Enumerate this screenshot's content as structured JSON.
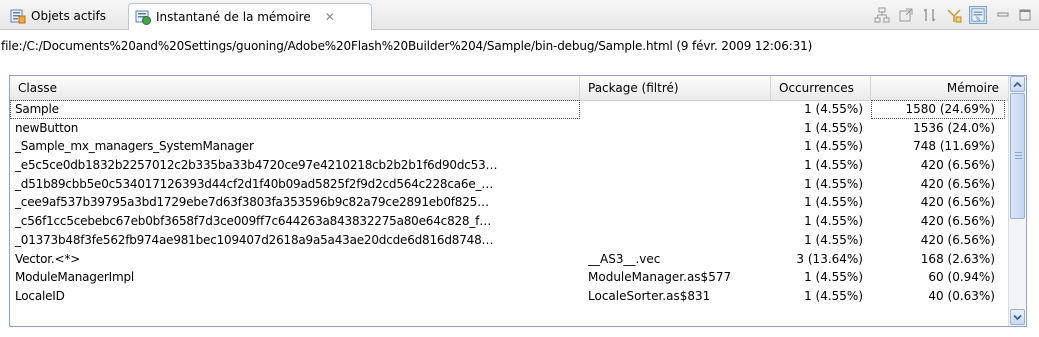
{
  "tabs": [
    {
      "label": "Objets actifs",
      "icon": "live-objects-icon"
    },
    {
      "label": "Instantané de la mémoire",
      "icon": "memory-snapshot-icon",
      "active": true
    }
  ],
  "path": "file:/C:/Documents%20and%20Settings/guoning/Adobe%20Flash%20Builder%204/Sample/bin-debug/Sample.html (9 févr. 2009 12:06:31)",
  "columns": [
    "Classe",
    "Package (filtré)",
    "Occurrences",
    "Mémoire"
  ],
  "rows": [
    {
      "classe": "Sample",
      "package": "",
      "occurrences": "1 (4.55%)",
      "memoire": "1580 (24.69%)"
    },
    {
      "classe": "newButton",
      "package": "",
      "occurrences": "1 (4.55%)",
      "memoire": "1536 (24.0%)"
    },
    {
      "classe": "_Sample_mx_managers_SystemManager",
      "package": "",
      "occurrences": "1 (4.55%)",
      "memoire": "748 (11.69%)"
    },
    {
      "classe": "_e5c5ce0db1832b2257012c2b335ba33b4720ce97e4210218cb2b2b1f6d90dc53…",
      "package": "",
      "occurrences": "1 (4.55%)",
      "memoire": "420 (6.56%)"
    },
    {
      "classe": "_d51b89cbb5e0c534017126393d44cf2d1f40b09ad5825f2f9d2cd564c228ca6e_…",
      "package": "",
      "occurrences": "1 (4.55%)",
      "memoire": "420 (6.56%)"
    },
    {
      "classe": "_cee9af537b39795a3bd1729ebe7d63f3803fa353596b9c82a79ce2891eb0f825…",
      "package": "",
      "occurrences": "1 (4.55%)",
      "memoire": "420 (6.56%)"
    },
    {
      "classe": "_c56f1cc5cebebc67eb0bf3658f7d3ce009ff7c644263a843832275a80e64c828_f…",
      "package": "",
      "occurrences": "1 (4.55%)",
      "memoire": "420 (6.56%)"
    },
    {
      "classe": "_01373b48f3fe562fb974ae981bec109407d2618a9a5a43ae20dcde6d816d8748…",
      "package": "",
      "occurrences": "1 (4.55%)",
      "memoire": "420 (6.56%)"
    },
    {
      "classe": "Vector.<*>",
      "package": "__AS3__.vec",
      "occurrences": "3 (13.64%)",
      "memoire": "168 (2.63%)"
    },
    {
      "classe": "ModuleManagerImpl",
      "package": "ModuleManager.as$577",
      "occurrences": "1 (4.55%)",
      "memoire": "60 (0.94%)"
    },
    {
      "classe": "LocaleID",
      "package": "LocaleSorter.as$831",
      "occurrences": "1 (4.55%)",
      "memoire": "40 (0.63%)"
    }
  ],
  "toolbar_icons": [
    "hierarchy-icon",
    "open-type-icon",
    "find-loitering-icon",
    "filters-icon",
    "package-toggle-icon"
  ],
  "colors": {
    "tab_border": "#b9c6d8",
    "scroll_blue": "#c3d6f2",
    "selected_outline": "#555555"
  }
}
